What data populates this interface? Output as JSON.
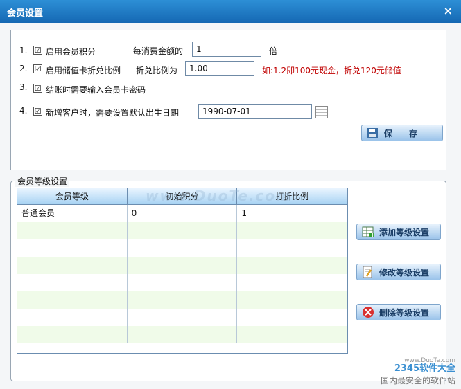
{
  "titlebar": {
    "title": "会员设置",
    "close": "×"
  },
  "options": [
    {
      "num": "1.",
      "label": "启用会员积分",
      "checked": "☑"
    },
    {
      "num": "2.",
      "label": "启用储值卡折兑比例",
      "checked": "☑"
    },
    {
      "num": "3.",
      "label": "结账时需要输入会员卡密码",
      "checked": "☑"
    },
    {
      "num": "4.",
      "label": "新增客户时，需要设置默认出生日期",
      "checked": "☑"
    }
  ],
  "points": {
    "label": "每消费金额的",
    "value": "1",
    "unit": "倍"
  },
  "ratio": {
    "label": "折兑比例为",
    "value": "1.00",
    "hint": "如:1.2即100元现金，折兑120元储值"
  },
  "birthday": {
    "value": "1990-07-01"
  },
  "save_button": {
    "label": "保　　存"
  },
  "level_group": {
    "legend": "会员等级设置"
  },
  "grid": {
    "headers": [
      "会员等级",
      "初始积分",
      "打折比例"
    ],
    "rows": [
      {
        "level": "普通会员",
        "points": "0",
        "discount": "1"
      }
    ]
  },
  "buttons": {
    "add": "添加等级设置",
    "edit": "修改等级设置",
    "delete": "删除等级设置"
  },
  "watermark": {
    "text": "www.DuoTe.com",
    "logo": "2345软件大全",
    "url": "www.DuoTe.com",
    "site": "国内最安全的软件站"
  }
}
